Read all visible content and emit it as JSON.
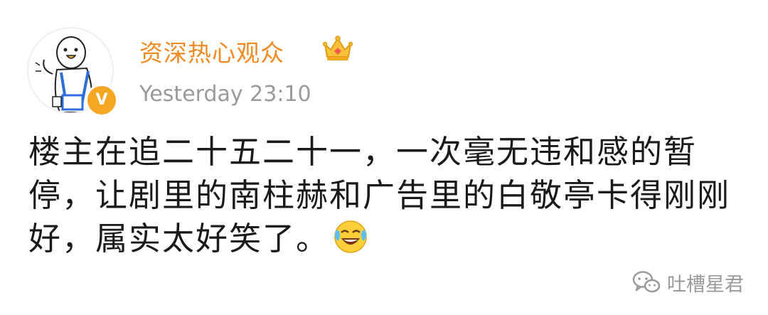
{
  "post": {
    "username": "资深热心观众",
    "timestamp": "Yesterday 23:10",
    "text": "楼主在追二十五二十一，一次毫无违和感的暂停，让剧里的南柱赫和广告里的白敬亭卡得刚刚好，属实太好笑了。"
  },
  "badges": {
    "verified": "V"
  },
  "icons": {
    "crown": "crown-icon",
    "emoji": "laughing-tears-emoji",
    "watermark": "wechat-icon",
    "verified": "verified-badge-icon"
  },
  "watermark": {
    "text": "吐槽星君"
  },
  "colors": {
    "username": "#f08a23",
    "timestamp": "#9a9a9a",
    "text": "#1a1a1a",
    "badge": "#f5a623",
    "watermark": "#9a9a9a"
  }
}
